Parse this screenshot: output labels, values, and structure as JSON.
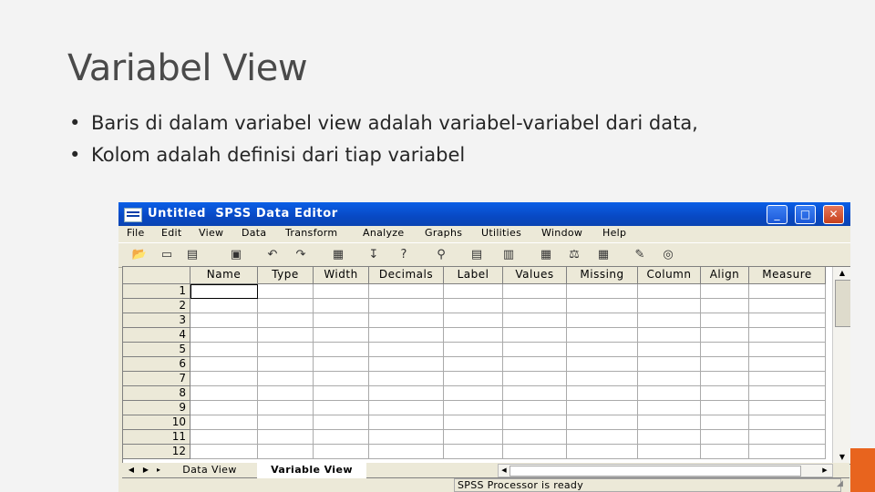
{
  "slide": {
    "title": "Variabel View",
    "bullet_1": "Baris di dalam variabel view adalah variabel-variabel dari data,",
    "bullet_2": "Kolom adalah definisi dari tiap variabel",
    "bullet_symbol": "•"
  },
  "window": {
    "title": "Untitled  SPSS Data Editor",
    "controls": {
      "minimize": "_",
      "maximize": "□",
      "close": "✕"
    }
  },
  "menu": [
    "File",
    "Edit",
    "View",
    "Data",
    "Transform",
    "Analyze",
    "Graphs",
    "Utilities",
    "Window",
    "Help"
  ],
  "toolbar_icons": [
    "open-icon",
    "save-icon",
    "print-icon",
    "dialog-recall-icon",
    "undo-icon",
    "redo-icon",
    "goto-chart-icon",
    "goto-case-icon",
    "variables-icon",
    "find-icon",
    "insert-case-icon",
    "insert-variable-icon",
    "split-file-icon",
    "weight-cases-icon",
    "select-cases-icon",
    "value-labels-icon",
    "use-sets-icon"
  ],
  "grid": {
    "columns": [
      "Name",
      "Type",
      "Width",
      "Decimals",
      "Label",
      "Values",
      "Missing",
      "Column",
      "Align",
      "Measure"
    ],
    "row_numbers": [
      "1",
      "2",
      "3",
      "4",
      "5",
      "6",
      "7",
      "8",
      "9",
      "10",
      "11",
      "12"
    ]
  },
  "tabs": {
    "data_view": "Data View",
    "variable_view": "Variable View",
    "active": "Variable View"
  },
  "status": {
    "message": "SPSS Processor  is ready"
  },
  "colors": {
    "titlebar": "#0a53d8",
    "accent": "#e8641e",
    "window_face": "#ece9d8"
  }
}
